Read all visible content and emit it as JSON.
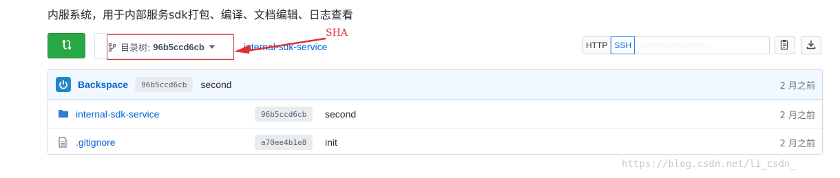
{
  "repo": {
    "description": "内服系统，用于内部服务sdk打包、编译、文档编辑、日志查看"
  },
  "branch": {
    "prefix": "目录树:",
    "sha": "96b5ccd6cb"
  },
  "breadcrumb": "internal-sdk-service",
  "annotation": {
    "label": "SHA",
    "color": "#e0302f"
  },
  "clone": {
    "http_label": "HTTP",
    "ssh_label": "SSH",
    "url": "·······················"
  },
  "latest_commit": {
    "author": "Backspace",
    "sha": "96b5ccd6cb",
    "message": "second",
    "age": "2 月之前"
  },
  "files": [
    {
      "type": "folder",
      "name": "internal-sdk-service",
      "sha": "96b5ccd6cb",
      "message": "second",
      "age": "2 月之前"
    },
    {
      "type": "file",
      "name": ".gitignore",
      "sha": "a70ee4b1e8",
      "message": "init",
      "age": "2 月之前"
    }
  ],
  "watermark": "https://blog.csdn.net/li_csdn_",
  "colors": {
    "accent_green": "#28a745",
    "link_blue": "#0366d6",
    "commit_bar": "#f1f8ff"
  }
}
